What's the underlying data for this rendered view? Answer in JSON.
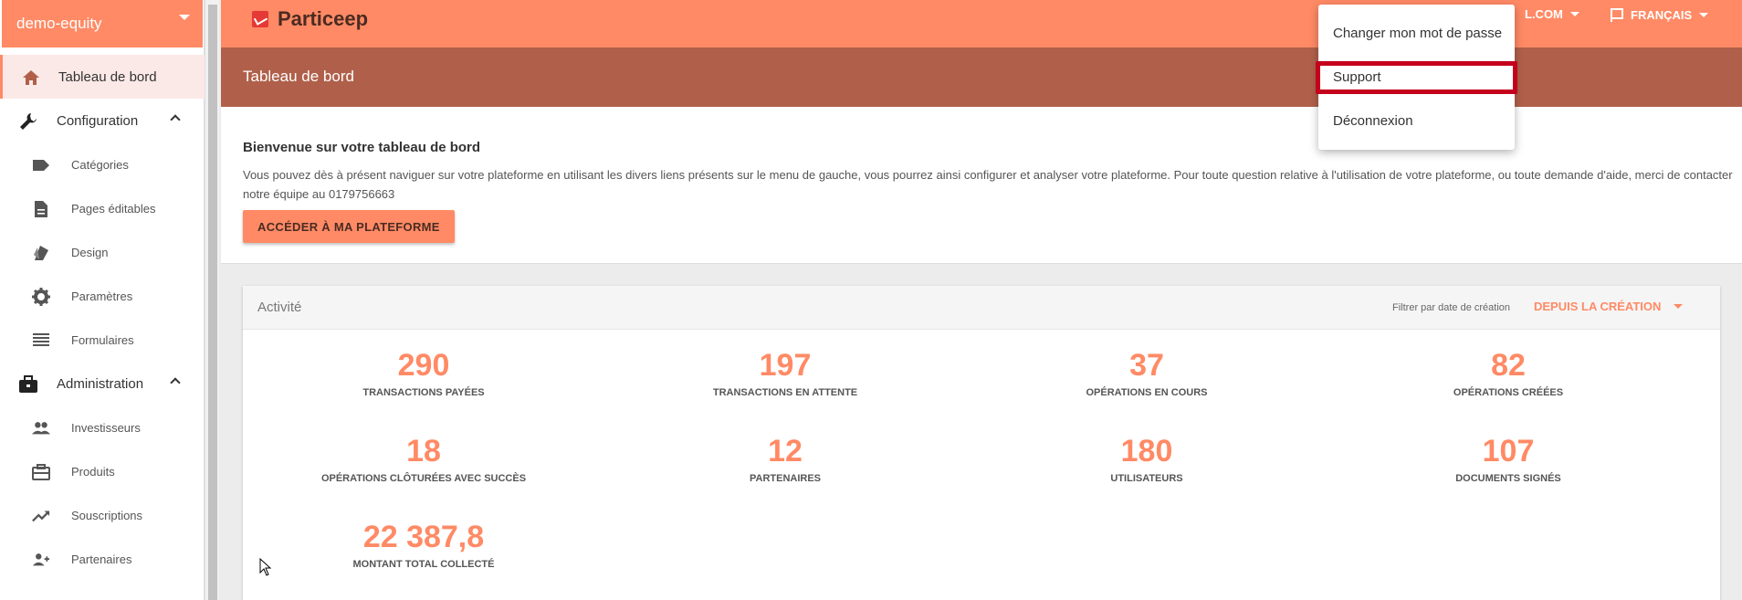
{
  "sidebar": {
    "tenant": "demo-equity",
    "items": [
      {
        "label": "Tableau de bord",
        "icon": "home-icon",
        "active": true
      },
      {
        "label": "Configuration",
        "icon": "wrench-icon",
        "group": true
      },
      {
        "label": "Catégories",
        "icon": "label-icon"
      },
      {
        "label": "Pages éditables",
        "icon": "document-icon"
      },
      {
        "label": "Design",
        "icon": "palette-icon"
      },
      {
        "label": "Paramètres",
        "icon": "gear-icon"
      },
      {
        "label": "Formulaires",
        "icon": "list-icon"
      },
      {
        "label": "Administration",
        "icon": "briefcase-icon",
        "group": true
      },
      {
        "label": "Investisseurs",
        "icon": "people-icon"
      },
      {
        "label": "Produits",
        "icon": "case-icon"
      },
      {
        "label": "Souscriptions",
        "icon": "trending-icon"
      },
      {
        "label": "Partenaires",
        "icon": "partners-icon"
      }
    ]
  },
  "topbar": {
    "logo": "Particeep",
    "user_label": "L.COM",
    "language": "FRANÇAIS"
  },
  "page_title": "Tableau de bord",
  "welcome": {
    "heading": "Bienvenue sur votre tableau de bord",
    "text": "Vous pouvez dès à présent naviguer sur votre plateforme en utilisant les divers liens présents sur le menu de gauche, vous pourrez ainsi configurer et analyser votre plateforme. Pour toute question relative à l'utilisation de votre plateforme, ou toute demande d'aide, merci de contacter notre équipe au 0179756663",
    "cta": "ACCÉDER À MA PLATEFORME"
  },
  "activity": {
    "title": "Activité",
    "filter_label": "Filtrer par date de création",
    "filter_value": "DEPUIS LA CRÉATION",
    "stats": [
      {
        "value": "290",
        "label": "TRANSACTIONS PAYÉES"
      },
      {
        "value": "197",
        "label": "TRANSACTIONS EN ATTENTE"
      },
      {
        "value": "37",
        "label": "OPÉRATIONS EN COURS"
      },
      {
        "value": "82",
        "label": "OPÉRATIONS CRÉÉES"
      },
      {
        "value": "18",
        "label": "OPÉRATIONS CLÔTURÉES AVEC SUCCÈS"
      },
      {
        "value": "12",
        "label": "PARTENAIRES"
      },
      {
        "value": "180",
        "label": "UTILISATEURS"
      },
      {
        "value": "107",
        "label": "DOCUMENTS SIGNÉS"
      },
      {
        "value": "22 387,8",
        "label": "MONTANT TOTAL COLLECTÉ"
      }
    ]
  },
  "user_dropdown": {
    "options": [
      "Changer mon mot de passe",
      "Support",
      "Déconnexion"
    ],
    "highlighted": "Support"
  },
  "colors": {
    "accent": "#ff8a65",
    "title_bar": "#b0604a",
    "highlight": "#c4001c"
  }
}
